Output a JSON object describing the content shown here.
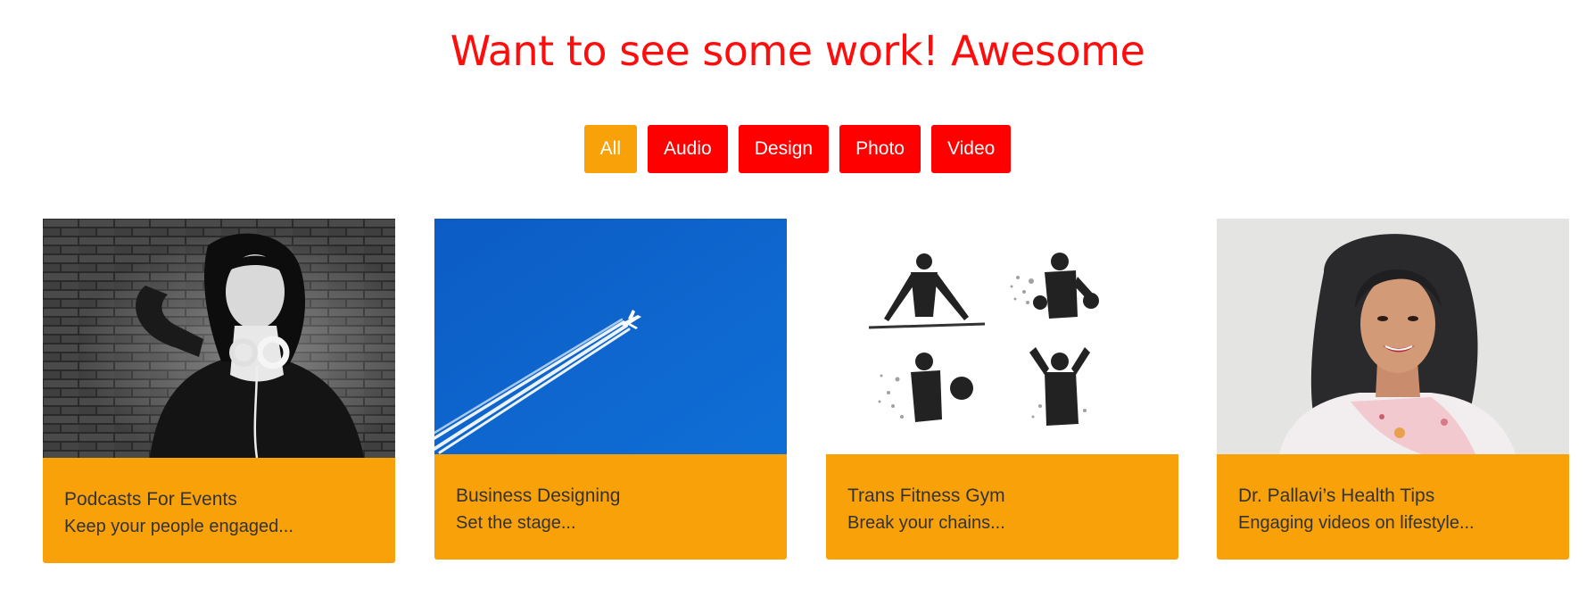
{
  "heading": "Want to see some work! Awesome",
  "filters": [
    {
      "label": "All",
      "active": true
    },
    {
      "label": "Audio",
      "active": false
    },
    {
      "label": "Design",
      "active": false
    },
    {
      "label": "Photo",
      "active": false
    },
    {
      "label": "Video",
      "active": false
    }
  ],
  "colors": {
    "heading": "#ff0d0d",
    "filter_bg": "#ff0000",
    "filter_active_bg": "#f9a108",
    "caption_bg": "#f9a108",
    "caption_text": "#333333"
  },
  "cards": [
    {
      "title": "Podcasts For Events",
      "desc": "Keep your people engaged...",
      "image": "woman-with-headphones-photo"
    },
    {
      "title": "Business Designing",
      "desc": "Set the stage...",
      "image": "airplane-contrail-sky-photo"
    },
    {
      "title": "Trans Fitness Gym",
      "desc": "Break your chains...",
      "image": "fitness-silhouettes-illustration"
    },
    {
      "title": "Dr. Pallavi’s Health Tips",
      "desc": "Engaging videos on lifestyle...",
      "image": "smiling-woman-portrait-photo"
    }
  ]
}
